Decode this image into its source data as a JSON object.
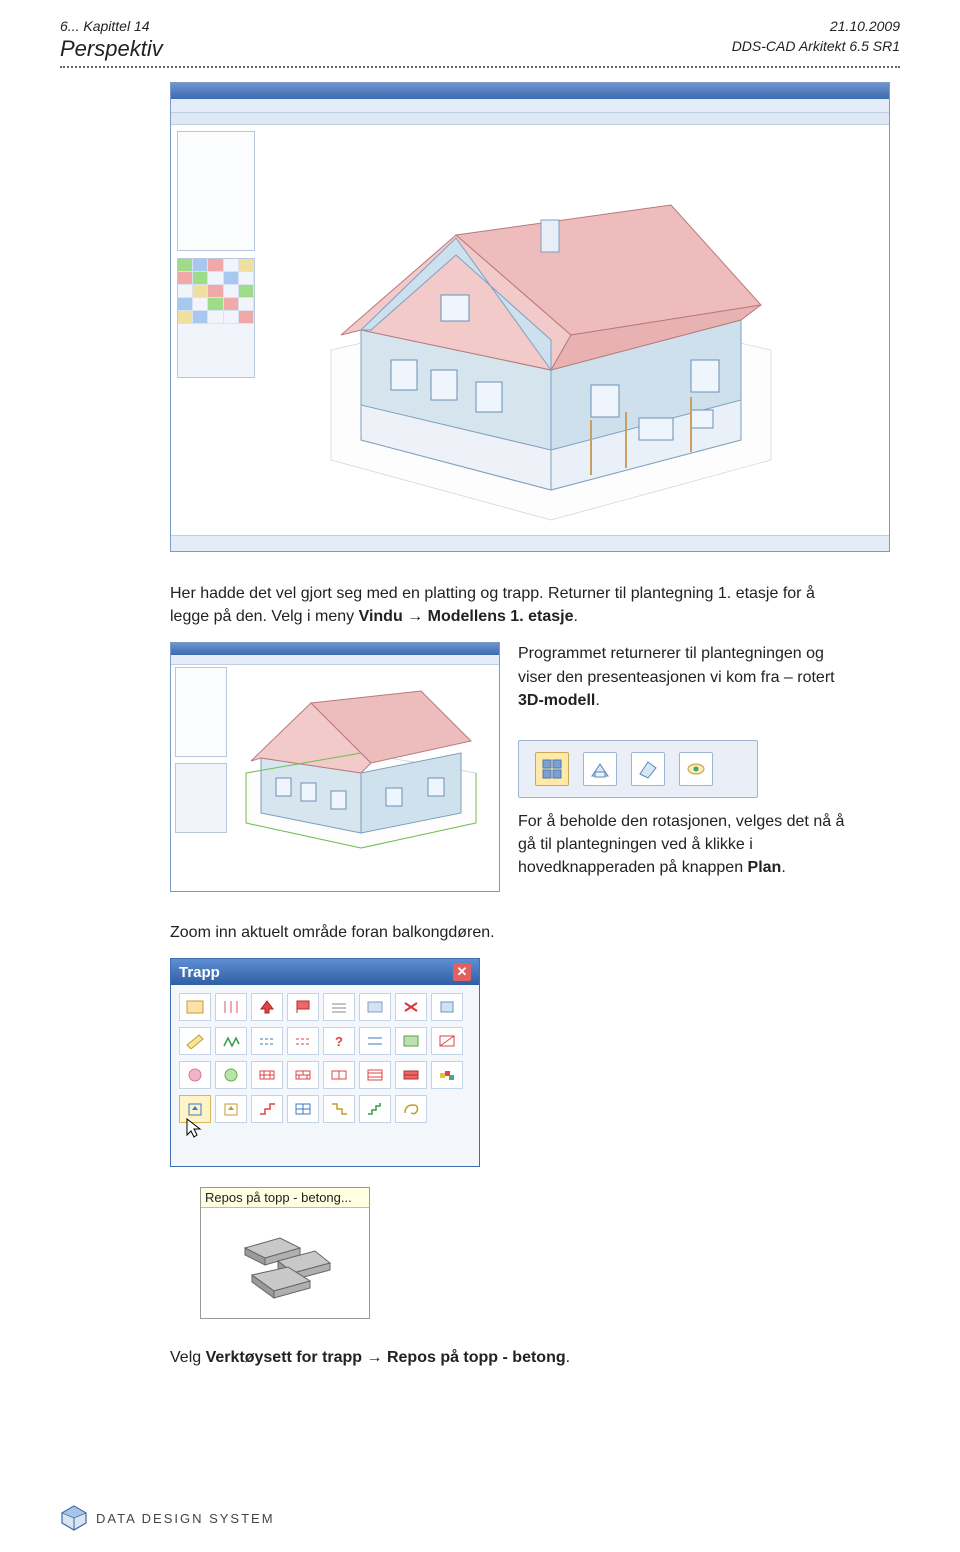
{
  "header": {
    "page_number": "6",
    "chapter": "... Kapittel 14",
    "title": "Perspektiv",
    "date": "21.10.2009",
    "software": "DDS-CAD Arkitekt  6.5 SR1"
  },
  "para1": {
    "t1": "Her hadde det vel gjort seg med en platting og trapp. Returner til plantegning 1. etasje for å legge på den. Velg i meny ",
    "b1": "Vindu",
    "arrow": " → ",
    "b2": "Modellens 1. etasje",
    "t2": "."
  },
  "para2": {
    "t1": "Programmet returnerer til plantegningen og viser den presenteasjonen vi kom fra – rotert ",
    "b1": "3D-modell",
    "t2": "."
  },
  "para3": {
    "t1": "For å beholde den rotasjonen, velges det nå å gå til plantegningen ved å klikke i hovedknapperaden på knappen ",
    "b1": "Plan",
    "t2": "."
  },
  "para_zoom": "Zoom inn aktuelt område foran balkongdøren.",
  "trapp": {
    "title": "Trapp",
    "tooltip_label": "Repos på topp - betong..."
  },
  "para_bottom": {
    "t1": "Velg ",
    "b1": "Verktøysett for trapp",
    "arrow": " → ",
    "b2": "Repos på topp - betong",
    "t2": "."
  },
  "footer": {
    "company": "DATA DESIGN SYSTEM"
  },
  "icons": {
    "close": "✕"
  }
}
